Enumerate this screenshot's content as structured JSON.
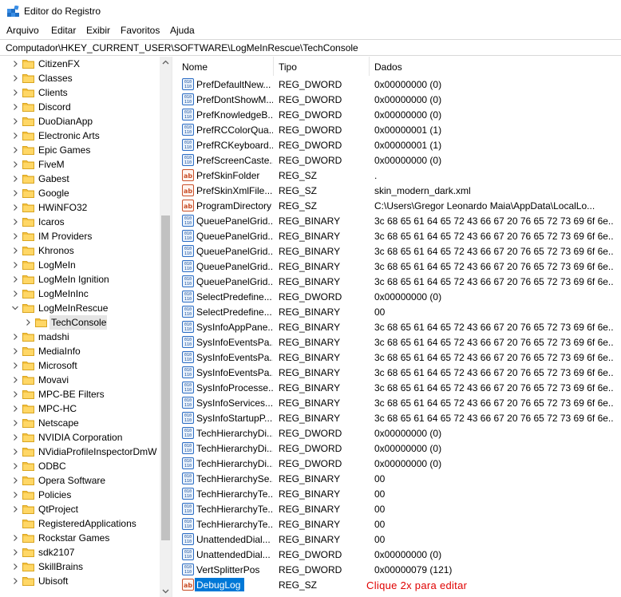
{
  "window": {
    "title": "Editor do Registro",
    "icon": "registry-editor-icon"
  },
  "menu": [
    "Arquivo",
    "Editar",
    "Exibir",
    "Favoritos",
    "Ajuda"
  ],
  "address": "Computador\\HKEY_CURRENT_USER\\SOFTWARE\\LogMeInRescue\\TechConsole",
  "tree": [
    {
      "label": "CitizenFX",
      "chevron": "right",
      "indent": 0
    },
    {
      "label": "Classes",
      "chevron": "right",
      "indent": 0
    },
    {
      "label": "Clients",
      "chevron": "right",
      "indent": 0
    },
    {
      "label": "Discord",
      "chevron": "right",
      "indent": 0
    },
    {
      "label": "DuoDianApp",
      "chevron": "right",
      "indent": 0
    },
    {
      "label": "Electronic Arts",
      "chevron": "right",
      "indent": 0
    },
    {
      "label": "Epic Games",
      "chevron": "right",
      "indent": 0
    },
    {
      "label": "FiveM",
      "chevron": "right",
      "indent": 0
    },
    {
      "label": "Gabest",
      "chevron": "right",
      "indent": 0
    },
    {
      "label": "Google",
      "chevron": "right",
      "indent": 0
    },
    {
      "label": "HWiNFO32",
      "chevron": "right",
      "indent": 0
    },
    {
      "label": "Icaros",
      "chevron": "right",
      "indent": 0
    },
    {
      "label": "IM Providers",
      "chevron": "right",
      "indent": 0
    },
    {
      "label": "Khronos",
      "chevron": "right",
      "indent": 0
    },
    {
      "label": "LogMeIn",
      "chevron": "right",
      "indent": 0
    },
    {
      "label": "LogMeIn Ignition",
      "chevron": "right",
      "indent": 0
    },
    {
      "label": "LogMeInInc",
      "chevron": "right",
      "indent": 0
    },
    {
      "label": "LogMeInRescue",
      "chevron": "down",
      "indent": 0
    },
    {
      "label": "TechConsole",
      "chevron": "right",
      "indent": 1,
      "selected": true
    },
    {
      "label": "madshi",
      "chevron": "right",
      "indent": 0
    },
    {
      "label": "MediaInfo",
      "chevron": "right",
      "indent": 0
    },
    {
      "label": "Microsoft",
      "chevron": "right",
      "indent": 0
    },
    {
      "label": "Movavi",
      "chevron": "right",
      "indent": 0
    },
    {
      "label": "MPC-BE Filters",
      "chevron": "right",
      "indent": 0
    },
    {
      "label": "MPC-HC",
      "chevron": "right",
      "indent": 0
    },
    {
      "label": "Netscape",
      "chevron": "right",
      "indent": 0
    },
    {
      "label": "NVIDIA Corporation",
      "chevron": "right",
      "indent": 0
    },
    {
      "label": "NVidiaProfileInspectorDmW",
      "chevron": "right",
      "indent": 0
    },
    {
      "label": "ODBC",
      "chevron": "right",
      "indent": 0
    },
    {
      "label": "Opera Software",
      "chevron": "right",
      "indent": 0
    },
    {
      "label": "Policies",
      "chevron": "right",
      "indent": 0
    },
    {
      "label": "QtProject",
      "chevron": "right",
      "indent": 0
    },
    {
      "label": "RegisteredApplications",
      "chevron": "none",
      "indent": 0
    },
    {
      "label": "Rockstar Games",
      "chevron": "right",
      "indent": 0
    },
    {
      "label": "sdk2107",
      "chevron": "right",
      "indent": 0
    },
    {
      "label": "SkillBrains",
      "chevron": "right",
      "indent": 0
    },
    {
      "label": "Ubisoft",
      "chevron": "right",
      "indent": 0
    }
  ],
  "columns": {
    "name": "Nome",
    "type": "Tipo",
    "data": "Dados"
  },
  "values": [
    {
      "name": "PrefDefaultNew...",
      "type": "REG_DWORD",
      "data": "0x00000000 (0)",
      "icon": "binary-value-icon"
    },
    {
      "name": "PrefDontShowM...",
      "type": "REG_DWORD",
      "data": "0x00000000 (0)",
      "icon": "binary-value-icon"
    },
    {
      "name": "PrefKnowledgeB...",
      "type": "REG_DWORD",
      "data": "0x00000000 (0)",
      "icon": "binary-value-icon"
    },
    {
      "name": "PrefRCColorQua...",
      "type": "REG_DWORD",
      "data": "0x00000001 (1)",
      "icon": "binary-value-icon"
    },
    {
      "name": "PrefRCKeyboard...",
      "type": "REG_DWORD",
      "data": "0x00000001 (1)",
      "icon": "binary-value-icon"
    },
    {
      "name": "PrefScreenCaste...",
      "type": "REG_DWORD",
      "data": "0x00000000 (0)",
      "icon": "binary-value-icon"
    },
    {
      "name": "PrefSkinFolder",
      "type": "REG_SZ",
      "data": ".",
      "icon": "string-value-icon"
    },
    {
      "name": "PrefSkinXmlFile...",
      "type": "REG_SZ",
      "data": "skin_modern_dark.xml",
      "icon": "string-value-icon"
    },
    {
      "name": "ProgramDirectory",
      "type": "REG_SZ",
      "data": "C:\\Users\\Gregor Leonardo Maia\\AppData\\LocalLo...",
      "icon": "string-value-icon"
    },
    {
      "name": "QueuePanelGrid...",
      "type": "REG_BINARY",
      "data": "3c 68 65 61 64 65 72 43 66 67 20 76 65 72 73 69 6f 6e...",
      "icon": "binary-value-icon"
    },
    {
      "name": "QueuePanelGrid...",
      "type": "REG_BINARY",
      "data": "3c 68 65 61 64 65 72 43 66 67 20 76 65 72 73 69 6f 6e...",
      "icon": "binary-value-icon"
    },
    {
      "name": "QueuePanelGrid...",
      "type": "REG_BINARY",
      "data": "3c 68 65 61 64 65 72 43 66 67 20 76 65 72 73 69 6f 6e...",
      "icon": "binary-value-icon"
    },
    {
      "name": "QueuePanelGrid...",
      "type": "REG_BINARY",
      "data": "3c 68 65 61 64 65 72 43 66 67 20 76 65 72 73 69 6f 6e...",
      "icon": "binary-value-icon"
    },
    {
      "name": "QueuePanelGrid...",
      "type": "REG_BINARY",
      "data": "3c 68 65 61 64 65 72 43 66 67 20 76 65 72 73 69 6f 6e...",
      "icon": "binary-value-icon"
    },
    {
      "name": "SelectPredefine...",
      "type": "REG_DWORD",
      "data": "0x00000000 (0)",
      "icon": "binary-value-icon"
    },
    {
      "name": "SelectPredefine...",
      "type": "REG_BINARY",
      "data": "00",
      "icon": "binary-value-icon"
    },
    {
      "name": "SysInfoAppPane...",
      "type": "REG_BINARY",
      "data": "3c 68 65 61 64 65 72 43 66 67 20 76 65 72 73 69 6f 6e...",
      "icon": "binary-value-icon"
    },
    {
      "name": "SysInfoEventsPa...",
      "type": "REG_BINARY",
      "data": "3c 68 65 61 64 65 72 43 66 67 20 76 65 72 73 69 6f 6e...",
      "icon": "binary-value-icon"
    },
    {
      "name": "SysInfoEventsPa...",
      "type": "REG_BINARY",
      "data": "3c 68 65 61 64 65 72 43 66 67 20 76 65 72 73 69 6f 6e...",
      "icon": "binary-value-icon"
    },
    {
      "name": "SysInfoEventsPa...",
      "type": "REG_BINARY",
      "data": "3c 68 65 61 64 65 72 43 66 67 20 76 65 72 73 69 6f 6e...",
      "icon": "binary-value-icon"
    },
    {
      "name": "SysInfoProcesse...",
      "type": "REG_BINARY",
      "data": "3c 68 65 61 64 65 72 43 66 67 20 76 65 72 73 69 6f 6e...",
      "icon": "binary-value-icon"
    },
    {
      "name": "SysInfoServices...",
      "type": "REG_BINARY",
      "data": "3c 68 65 61 64 65 72 43 66 67 20 76 65 72 73 69 6f 6e...",
      "icon": "binary-value-icon"
    },
    {
      "name": "SysInfoStartupP...",
      "type": "REG_BINARY",
      "data": "3c 68 65 61 64 65 72 43 66 67 20 76 65 72 73 69 6f 6e...",
      "icon": "binary-value-icon"
    },
    {
      "name": "TechHierarchyDi...",
      "type": "REG_DWORD",
      "data": "0x00000000 (0)",
      "icon": "binary-value-icon"
    },
    {
      "name": "TechHierarchyDi...",
      "type": "REG_DWORD",
      "data": "0x00000000 (0)",
      "icon": "binary-value-icon"
    },
    {
      "name": "TechHierarchyDi...",
      "type": "REG_DWORD",
      "data": "0x00000000 (0)",
      "icon": "binary-value-icon"
    },
    {
      "name": "TechHierarchySe...",
      "type": "REG_BINARY",
      "data": "00",
      "icon": "binary-value-icon"
    },
    {
      "name": "TechHierarchyTe...",
      "type": "REG_BINARY",
      "data": "00",
      "icon": "binary-value-icon"
    },
    {
      "name": "TechHierarchyTe...",
      "type": "REG_BINARY",
      "data": "00",
      "icon": "binary-value-icon"
    },
    {
      "name": "TechHierarchyTe...",
      "type": "REG_BINARY",
      "data": "00",
      "icon": "binary-value-icon"
    },
    {
      "name": "UnattendedDial...",
      "type": "REG_BINARY",
      "data": "00",
      "icon": "binary-value-icon"
    },
    {
      "name": "UnattendedDial...",
      "type": "REG_DWORD",
      "data": "0x00000000 (0)",
      "icon": "binary-value-icon"
    },
    {
      "name": "VertSplitterPos",
      "type": "REG_DWORD",
      "data": "0x00000079 (121)",
      "icon": "binary-value-icon"
    },
    {
      "name": "DebugLog",
      "type": "REG_SZ",
      "data": "",
      "icon": "string-value-icon",
      "selected": true,
      "annotation": "Clique 2x para editar"
    }
  ],
  "colors": {
    "selection": "#0078d7",
    "annotation": "#e00000",
    "folder": "#f5c242",
    "tree_selected": "#e5e5e5"
  }
}
